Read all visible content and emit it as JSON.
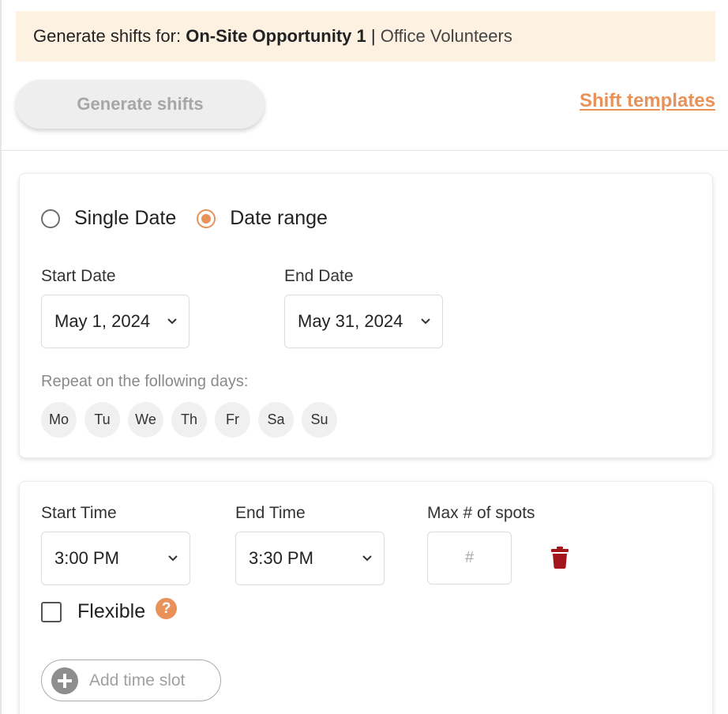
{
  "header": {
    "prefix": "Generate shifts for: ",
    "opportunity": "On-Site Opportunity 1",
    "separator": " | ",
    "group": "Office Volunteers"
  },
  "actions": {
    "generate_label": "Generate shifts",
    "templates_label": "Shift templates"
  },
  "date_card": {
    "mode_options": [
      {
        "label": "Single Date",
        "checked": false
      },
      {
        "label": "Date range",
        "checked": true
      }
    ],
    "start_date_label": "Start Date",
    "start_date_value": "May 1, 2024",
    "end_date_label": "End Date",
    "end_date_value": "May 31, 2024",
    "repeat_label": "Repeat on the following days:",
    "days": [
      "Mo",
      "Tu",
      "We",
      "Th",
      "Fr",
      "Sa",
      "Su"
    ]
  },
  "time_card": {
    "start_time_label": "Start Time",
    "start_time_value": "3:00 PM",
    "end_time_label": "End Time",
    "end_time_value": "3:30 PM",
    "max_spots_label": "Max # of spots",
    "max_spots_placeholder": "#",
    "flexible_label": "Flexible",
    "flexible_checked": false,
    "help_glyph": "?",
    "add_slot_label": "Add time slot"
  },
  "icons": {
    "chevron": "chevron-down-icon",
    "trash": "trash-icon",
    "help": "help-icon",
    "plus": "plus-circle-icon"
  },
  "colors": {
    "accent": "#e8925a",
    "banner_bg": "#fdf1e1",
    "danger": "#a3161d"
  }
}
